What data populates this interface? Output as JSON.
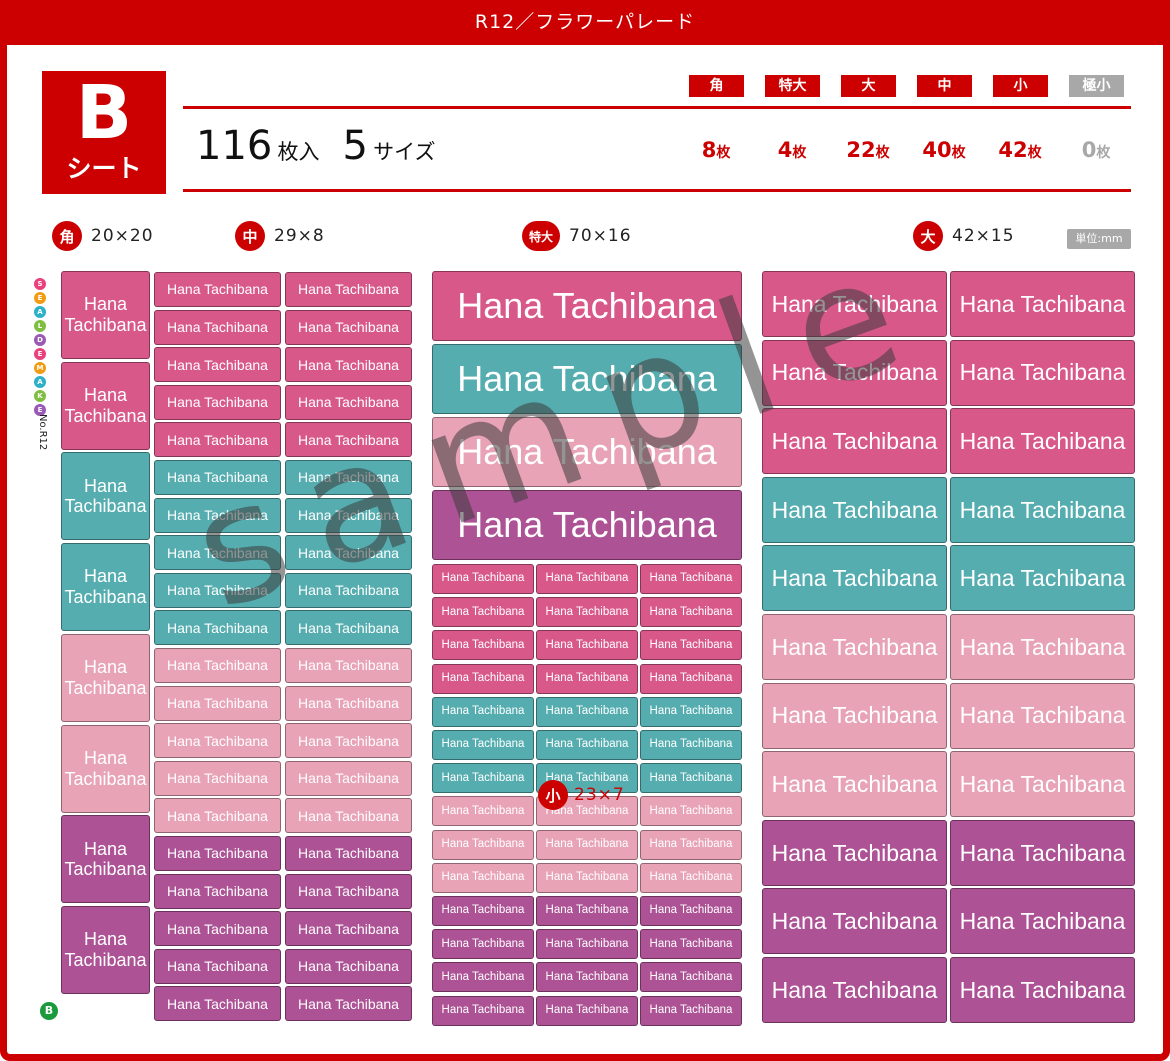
{
  "title": "R12／フラワーパレード",
  "sheet": {
    "letter": "B",
    "word": "シート"
  },
  "summary": {
    "total": "116",
    "total_unit": "枚入",
    "sizes": "5",
    "sizes_unit": "サイズ"
  },
  "sizes": [
    {
      "name": "角",
      "count": "8",
      "unit": "枚"
    },
    {
      "name": "特大",
      "count": "4",
      "unit": "枚"
    },
    {
      "name": "大",
      "count": "22",
      "unit": "枚"
    },
    {
      "name": "中",
      "count": "40",
      "unit": "枚"
    },
    {
      "name": "小",
      "count": "42",
      "unit": "枚"
    },
    {
      "name": "極小",
      "count": "0",
      "unit": "枚"
    }
  ],
  "dimensions": {
    "kaku": {
      "badge": "角",
      "size": "20×20"
    },
    "naka": {
      "badge": "中",
      "size": "29×8"
    },
    "tokudai": {
      "badge": "特大",
      "size": "70×16"
    },
    "dai": {
      "badge": "大",
      "size": "42×15"
    },
    "sho": {
      "badge": "小",
      "size": "23×7"
    }
  },
  "unit_label": "単位:mm",
  "brand": {
    "letters": [
      "S",
      "E",
      "A",
      "L",
      "D",
      "E",
      "M",
      "A",
      "K",
      "E"
    ],
    "number": "No.R12",
    "mark": "B"
  },
  "label_text": "Hana Tachibana",
  "label_text_split": [
    "Hana",
    "Tachibana"
  ],
  "watermark": "sample",
  "colors": {
    "accent": "#cc0000",
    "pink": "#d9588a",
    "teal": "#55adb0",
    "light_pink": "#e8a3b6",
    "plum": "#ad5295",
    "gray": "#a8a8a8"
  },
  "sheet_columns": {
    "kaku": [
      "pink",
      "pink",
      "teal",
      "teal",
      "light_pink",
      "light_pink",
      "plum",
      "plum"
    ],
    "naka": [
      "pink",
      "pink",
      "pink",
      "pink",
      "pink",
      "teal",
      "teal",
      "teal",
      "teal",
      "teal",
      "light_pink",
      "light_pink",
      "light_pink",
      "light_pink",
      "light_pink",
      "plum",
      "plum",
      "plum",
      "plum",
      "plum"
    ],
    "tokudai": [
      "pink",
      "teal",
      "light_pink",
      "plum"
    ],
    "sho": [
      "pink",
      "pink",
      "pink",
      "pink",
      "teal",
      "teal",
      "teal",
      "light_pink",
      "light_pink",
      "light_pink",
      "plum",
      "plum",
      "plum",
      "plum"
    ],
    "dai": [
      "pink",
      "pink",
      "pink",
      "teal",
      "teal",
      "light_pink",
      "light_pink",
      "light_pink",
      "plum",
      "plum",
      "plum"
    ]
  }
}
